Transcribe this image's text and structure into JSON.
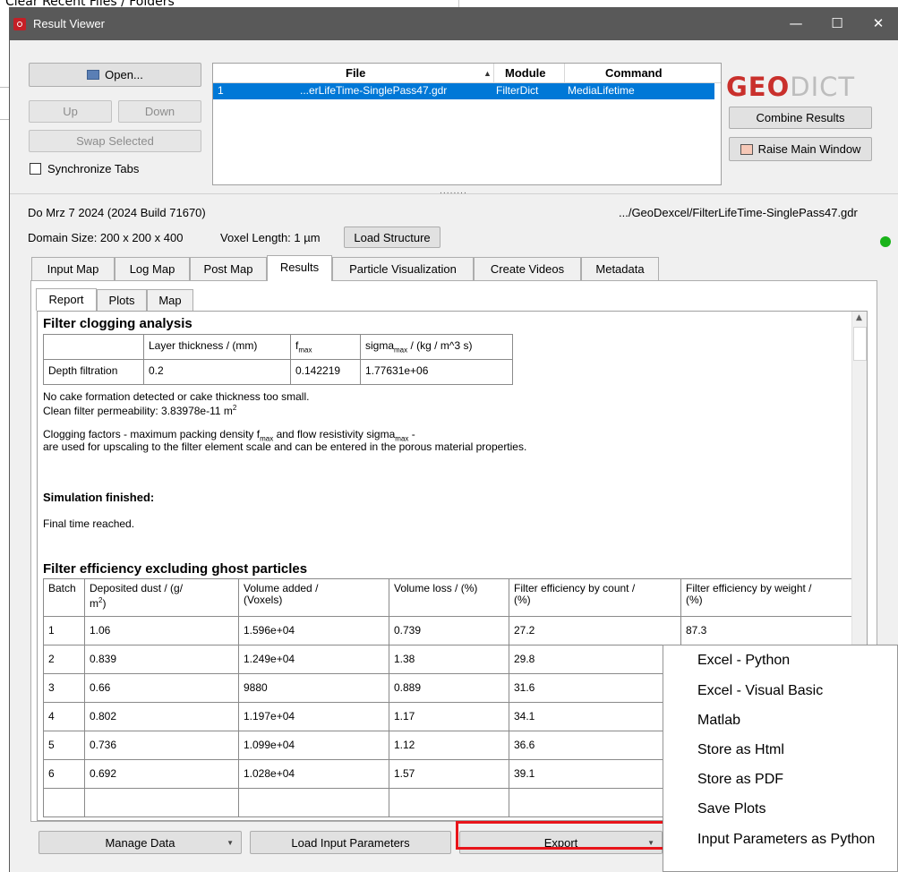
{
  "background_app": {
    "menu_text": "Clear Recent Files / Folders"
  },
  "window": {
    "title": "Result Viewer",
    "controls": {
      "minimize": "—",
      "maximize": "☐",
      "close": "✕"
    }
  },
  "top_controls": {
    "open_label": "Open...",
    "up_label": "Up",
    "down_label": "Down",
    "swap_label": "Swap Selected",
    "sync_label": "Synchronize Tabs"
  },
  "file_table": {
    "headers": {
      "file": "File",
      "module": "Module",
      "command": "Command"
    },
    "sort_indicator": "▲",
    "rows": [
      {
        "index": "1",
        "file": "...erLifeTime-SinglePass47.gdr",
        "module": "FilterDict",
        "command": "MediaLifetime"
      }
    ]
  },
  "logo": {
    "geo": "GEO",
    "dict": "DICT"
  },
  "right_controls": {
    "combine_label": "Combine Results",
    "raise_label": "Raise Main Window"
  },
  "splitter": "........",
  "info": {
    "date": "Do Mrz 7 2024 (2024 Build 71670)",
    "path": ".../GeoDexcel/FilterLifeTime-SinglePass47.gdr",
    "domain_size": "Domain Size: 200 x 200 x 400",
    "voxel_length": "Voxel Length: 1 µm",
    "load_structure": "Load Structure"
  },
  "tabs": [
    "Input Map",
    "Log Map",
    "Post Map",
    "Results",
    "Particle Visualization",
    "Create Videos",
    "Metadata"
  ],
  "subtabs": [
    "Report",
    "Plots",
    "Map"
  ],
  "report": {
    "clog_title": "Filter clogging analysis",
    "clog_headers": {
      "layer": "Layer thickness / (mm)",
      "fmax_f": "f",
      "fmax_sub": "max",
      "sigma": "sigma",
      "sigma_sub": "max",
      "sigma_unit": " / (kg / m^3 s)"
    },
    "clog_row": {
      "name": "Depth filtration",
      "layer": "0.2",
      "fmax": "0.142219",
      "sigma": "1.77631e+06"
    },
    "no_cake": "No cake formation detected or cake thickness too small.",
    "permeability": "Clean filter permeability: 3.83978e-11 m",
    "perm_sup": "2",
    "clog_factors_1a": "Clogging factors - maximum packing density f",
    "clog_factors_1_sub1": "max",
    "clog_factors_1b": " and flow resistivity sigma",
    "clog_factors_1_sub2": "max",
    "clog_factors_1c": " -",
    "clog_factors_2": "are used for upscaling to the filter element scale and can be entered in the porous material properties.",
    "sim_finished": "Simulation finished:",
    "final_time": "Final time reached.",
    "eff_title": "Filter efficiency excluding ghost particles",
    "eff_headers": {
      "batch": "Batch",
      "dust": "Deposited dust / (g/",
      "dust2": "m",
      "dust_sup": "2",
      "dust3": ")",
      "vol_add": "Volume added /",
      "vol_add2": "(Voxels)",
      "vol_loss": "Volume loss / (%)",
      "eff_count": "Filter efficiency by count /",
      "eff_count2": "(%)",
      "eff_weight": "Filter efficiency by weight /",
      "eff_weight2": "(%)"
    },
    "eff_rows": [
      {
        "batch": "1",
        "dust": "1.06",
        "vol_add": "1.596e+04",
        "vol_loss": "0.739",
        "count": "27.2",
        "weight": "87.3"
      },
      {
        "batch": "2",
        "dust": "0.839",
        "vol_add": "1.249e+04",
        "vol_loss": "1.38",
        "count": "29.8",
        "weight": ""
      },
      {
        "batch": "3",
        "dust": "0.66",
        "vol_add": "9880",
        "vol_loss": "0.889",
        "count": "31.6",
        "weight": ""
      },
      {
        "batch": "4",
        "dust": "0.802",
        "vol_add": "1.197e+04",
        "vol_loss": "1.17",
        "count": "34.1",
        "weight": ""
      },
      {
        "batch": "5",
        "dust": "0.736",
        "vol_add": "1.099e+04",
        "vol_loss": "1.12",
        "count": "36.6",
        "weight": ""
      },
      {
        "batch": "6",
        "dust": "0.692",
        "vol_add": "1.028e+04",
        "vol_loss": "1.57",
        "count": "39.1",
        "weight": ""
      }
    ]
  },
  "bottom": {
    "manage_label": "Manage Data",
    "load_params_label": "Load Input Parameters",
    "export_label": "Export"
  },
  "export_menu": [
    "Excel - Python",
    "Excel - Visual Basic",
    "Matlab",
    "Store as Html",
    "Store as PDF",
    "Save Plots",
    "Input Parameters as Python"
  ],
  "colors": {
    "titlebar": "#595959",
    "selection": "#0078d7",
    "logo_red": "#c9302c",
    "status_green": "#19b319",
    "highlight": "#e8141a"
  }
}
